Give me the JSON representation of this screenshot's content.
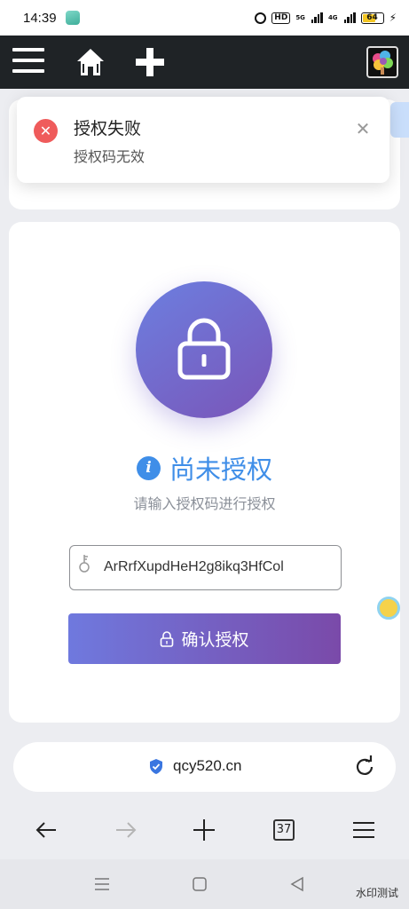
{
  "status_bar": {
    "time": "14:39",
    "hd_label": "HD",
    "net_label_1": "5G",
    "net_label_2": "4G",
    "battery": "64"
  },
  "header": {
    "menu_icon": "hamburger-menu-icon",
    "home_icon": "home-icon",
    "add_icon": "plus-icon"
  },
  "toast": {
    "title": "授权失败",
    "message": "授权码无效",
    "close_icon": "close-icon",
    "error_color": "#ef5b5b"
  },
  "auth": {
    "status_title": "尚未授权",
    "subtitle": "请输入授权码进行授权",
    "code_value": "ArRrfXupdHeH2g8ikq3HfCol",
    "confirm_label": "确认授权",
    "accent": "#3f8ee8"
  },
  "browser": {
    "url": "qcy520.cn",
    "tab_count": "37"
  },
  "watermark": "水印测试"
}
